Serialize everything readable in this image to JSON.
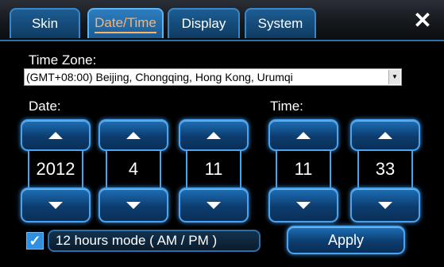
{
  "tabs": [
    {
      "label": "Skin",
      "active": false
    },
    {
      "label": "Date/Time",
      "active": true
    },
    {
      "label": "Display",
      "active": false
    },
    {
      "label": "System",
      "active": false
    }
  ],
  "close_icon_text": "✕",
  "timezone": {
    "label": "Time Zone:",
    "value": "(GMT+08:00) Beijing, Chongqing, Hong Kong, Urumqi"
  },
  "date_label": "Date:",
  "time_label": "Time:",
  "spinners": {
    "year": "2012",
    "month": "4",
    "day": "11",
    "hour": "11",
    "minute": "33"
  },
  "twelve_hour": {
    "checked": true,
    "label": "12 hours mode ( AM / PM )"
  },
  "apply_label": "Apply",
  "colors": {
    "accent": "#2f8fe0",
    "active_tab_text": "#ffb26a",
    "background": "#000000"
  }
}
